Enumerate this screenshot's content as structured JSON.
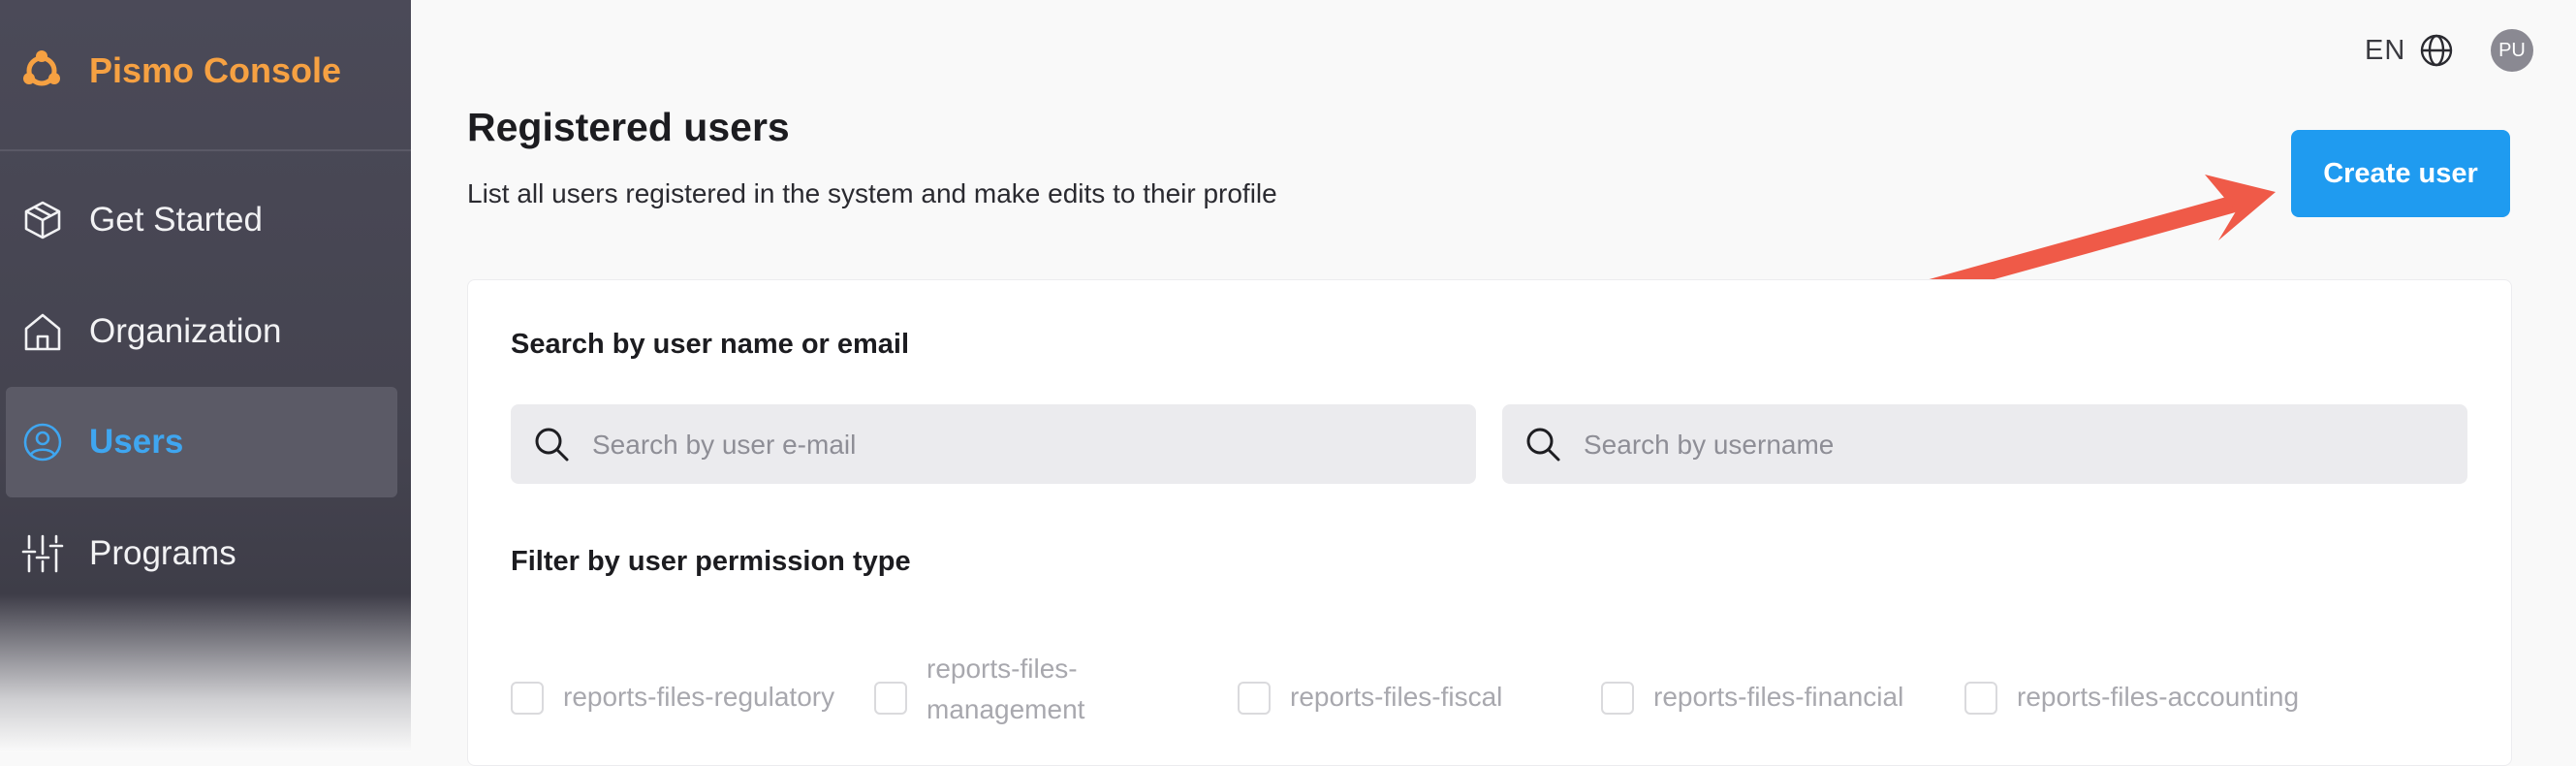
{
  "brand": {
    "name": "Pismo Console",
    "accent": "#f6a142"
  },
  "sidebar": {
    "items": [
      {
        "label": "Get Started",
        "icon": "package-icon",
        "active": false
      },
      {
        "label": "Organization",
        "icon": "home-icon",
        "active": false
      },
      {
        "label": "Users",
        "icon": "user-circle-icon",
        "active": true
      },
      {
        "label": "Programs",
        "icon": "sliders-icon",
        "active": false
      }
    ]
  },
  "topbar": {
    "language": "EN",
    "language_icon": "globe-icon",
    "avatar_initials": "PU"
  },
  "header": {
    "title": "Registered users",
    "subtitle": "List all users registered in the system and make edits to their profile",
    "create_button": "Create user",
    "create_button_color": "#1f9bf0"
  },
  "search": {
    "label": "Search by user name or email",
    "email_placeholder": "Search by user e-mail",
    "username_placeholder": "Search by username"
  },
  "filter": {
    "label": "Filter by user permission type",
    "permissions": [
      "reports-files-regulatory",
      "reports-files-management",
      "reports-files-fiscal",
      "reports-files-financial",
      "reports-files-accounting"
    ]
  },
  "annotation": {
    "arrow_color": "#ef5a48"
  }
}
